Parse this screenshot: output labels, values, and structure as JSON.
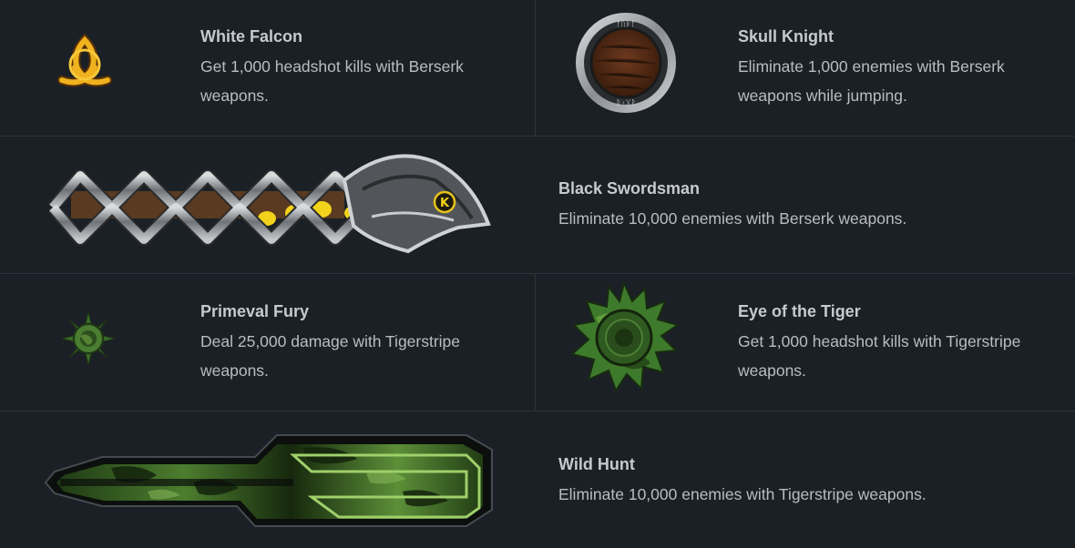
{
  "achievements": [
    {
      "title": "White Falcon",
      "description": "Get 1,000 headshot kills with Berserk weapons.",
      "icon": "triquetra-emblem-icon"
    },
    {
      "title": "Skull Knight",
      "description": "Eliminate 1,000 enemies with Berserk weapons while jumping.",
      "icon": "rune-shield-icon"
    },
    {
      "title": "Black Swordsman",
      "description": "Eliminate 10,000 enemies with Berserk weapons.",
      "icon": "celtic-dragon-banner-icon"
    },
    {
      "title": "Primeval Fury",
      "description": "Deal 25,000 damage with Tigerstripe weapons.",
      "icon": "camo-sun-emblem-icon"
    },
    {
      "title": "Eye of the Tiger",
      "description": "Get 1,000 headshot kills with Tigerstripe weapons.",
      "icon": "camo-gear-emblem-icon"
    },
    {
      "title": "Wild Hunt",
      "description": "Eliminate 10,000 enemies with Tigerstripe weapons.",
      "icon": "camo-banner-icon"
    }
  ],
  "colors": {
    "background": "#1b2026",
    "divider": "#2c333a",
    "title": "#c6cacd",
    "description": "#b9bdc1",
    "gold": "#e8a71b",
    "camo_green": "#3f6a2a"
  }
}
